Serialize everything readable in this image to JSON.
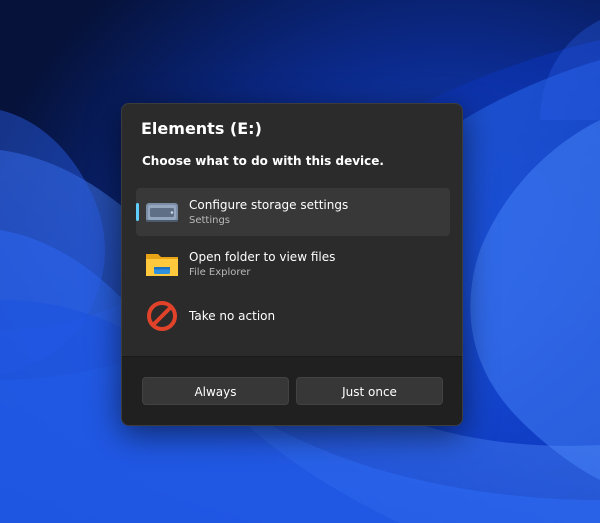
{
  "dialog": {
    "title": "Elements (E:)",
    "prompt": "Choose what to do with this device."
  },
  "options": [
    {
      "label": "Configure storage settings",
      "sublabel": "Settings",
      "icon": "storage-drive-icon",
      "selected": true
    },
    {
      "label": "Open folder to view files",
      "sublabel": "File Explorer",
      "icon": "folder-icon",
      "selected": false
    },
    {
      "label": "Take no action",
      "sublabel": "",
      "icon": "no-action-icon",
      "selected": false
    }
  ],
  "buttons": {
    "always_label": "Always",
    "once_label": "Just once"
  },
  "colors": {
    "accent": "#60cdff",
    "dialog_bg": "#2b2b2b",
    "wallpaper": "#0a1a4a"
  }
}
